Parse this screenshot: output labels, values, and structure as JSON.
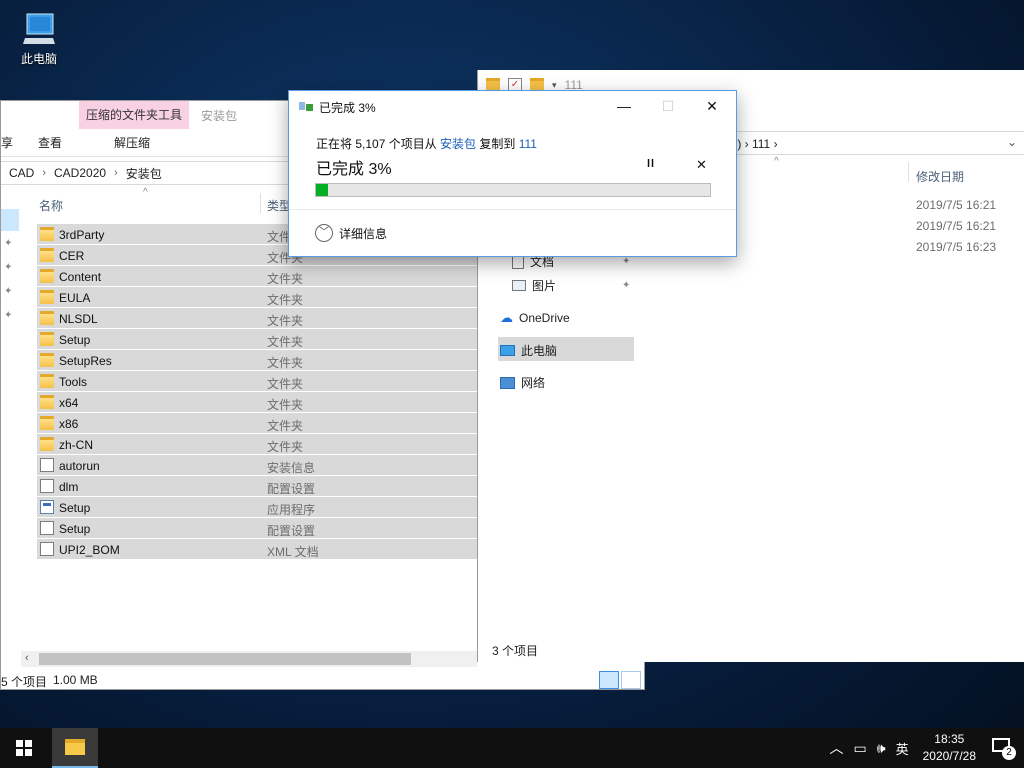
{
  "desktop": {
    "icon_label": "此电脑"
  },
  "left_window": {
    "ribbon": {
      "context_tab": "压缩的文件夹工具",
      "context_label": "安装包",
      "tab_share_partial": "享",
      "tab_view": "查看",
      "tab_extract": "解压缩"
    },
    "breadcrumb": [
      "CAD",
      "CAD2020",
      "安装包"
    ],
    "columns": {
      "name": "名称",
      "type": "类型"
    },
    "files": [
      {
        "name": "3rdParty",
        "type": "文件夹",
        "icon": "folder"
      },
      {
        "name": "CER",
        "type": "文件夹",
        "icon": "folder"
      },
      {
        "name": "Content",
        "type": "文件夹",
        "icon": "folder"
      },
      {
        "name": "EULA",
        "type": "文件夹",
        "icon": "folder"
      },
      {
        "name": "NLSDL",
        "type": "文件夹",
        "icon": "folder"
      },
      {
        "name": "Setup",
        "type": "文件夹",
        "icon": "folder"
      },
      {
        "name": "SetupRes",
        "type": "文件夹",
        "icon": "folder"
      },
      {
        "name": "Tools",
        "type": "文件夹",
        "icon": "folder"
      },
      {
        "name": "x64",
        "type": "文件夹",
        "icon": "folder"
      },
      {
        "name": "x86",
        "type": "文件夹",
        "icon": "folder"
      },
      {
        "name": "zh-CN",
        "type": "文件夹",
        "icon": "folder"
      },
      {
        "name": "autorun",
        "type": "安装信息",
        "icon": "doc"
      },
      {
        "name": "dlm",
        "type": "配置设置",
        "icon": "doc"
      },
      {
        "name": "Setup",
        "type": "应用程序",
        "icon": "app"
      },
      {
        "name": "Setup",
        "type": "配置设置",
        "icon": "doc"
      },
      {
        "name": "UPI2_BOM",
        "type": "XML 文档",
        "icon": "doc"
      }
    ],
    "status": {
      "count": "5 个项目",
      "size": "1.00 MB"
    }
  },
  "right_window": {
    "title": "111",
    "address": ":) › 111 ›",
    "columns": {
      "date": "修改日期"
    },
    "dates": [
      "2019/7/5 16:21",
      "2019/7/5 16:21",
      "2019/7/5 16:23"
    ],
    "nav": {
      "docs": "文档",
      "pictures": "图片",
      "onedrive": "OneDrive",
      "this_pc": "此电脑",
      "network": "网络"
    },
    "status": "3 个项目"
  },
  "dialog": {
    "title": "已完成 3%",
    "msg_prefix": "正在将 5,107 个项目从 ",
    "msg_src": "安装包",
    "msg_mid": " 复制到 ",
    "msg_dst": "111",
    "big_status": "已完成 3%",
    "progress": 0.03,
    "details": "详细信息",
    "progress_color": "#06b025"
  },
  "taskbar": {
    "ime": "英",
    "time": "18:35",
    "date": "2020/7/28",
    "notifications": "2"
  }
}
